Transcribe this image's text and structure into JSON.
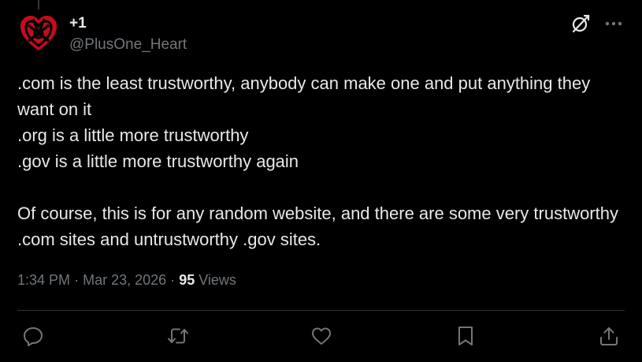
{
  "author": {
    "display_name": "+1",
    "handle": "@PlusOne_Heart",
    "avatar_icon": "red-celtic-heart-knot-icon"
  },
  "header_icons": [
    "grok-icon",
    "more-icon"
  ],
  "tweet": {
    "text": ".com is the least trustworthy, anybody can make one and put anything they want on it\n.org is a little more trustworthy\n.gov is a little more trustworthy again\n\nOf course, this is for any random website, and there are some very trustworthy .com sites and untrustworthy .gov sites."
  },
  "meta": {
    "time": "1:34 PM",
    "separator": "·",
    "date": "Mar 23, 2026",
    "views_count": "95",
    "views_label": "Views"
  },
  "actions": [
    "reply-icon",
    "retweet-icon",
    "like-icon",
    "bookmark-icon",
    "share-icon"
  ],
  "colors": {
    "background": "#000000",
    "text_primary": "#e7e9ea",
    "text_secondary": "#71767b",
    "divider": "#2f3336",
    "avatar_red": "#d0101e"
  }
}
